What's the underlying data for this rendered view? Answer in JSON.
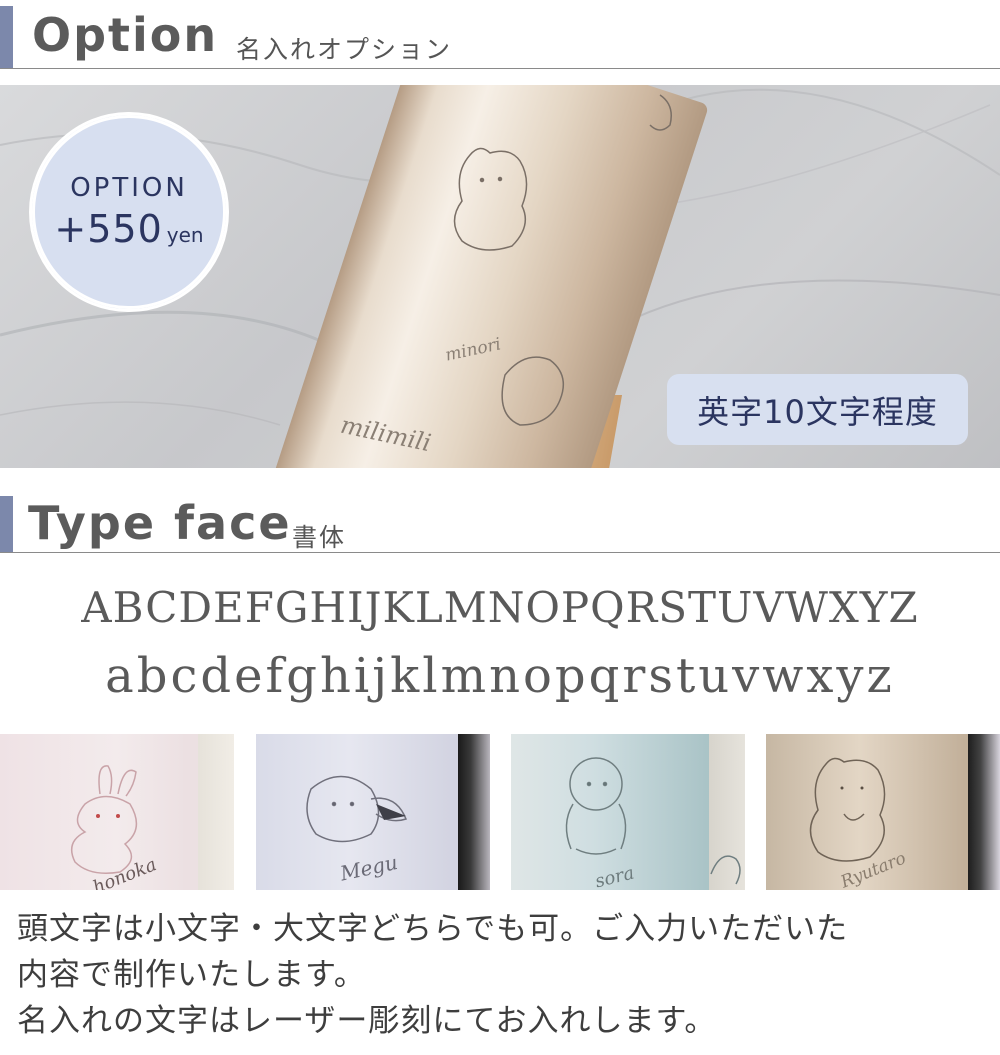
{
  "option_section": {
    "title": "Option",
    "subtitle": "名入れオプション"
  },
  "hero": {
    "badge_label": "OPTION",
    "badge_price": "+550",
    "badge_unit": "yen",
    "char_limit": "英字10文字程度",
    "engraving_name_1": "minori",
    "engraving_name_2": "milimili"
  },
  "typeface_section": {
    "title": "Type face",
    "subtitle": "書体"
  },
  "alphabet": {
    "uppercase": "ABCDEFGHIJKLMNOPQRSTUVWXYZ",
    "lowercase": "abcdefghijklmnopqrstuvwxyz"
  },
  "samples": [
    {
      "name": "honoka",
      "animal": "rabbit-icon"
    },
    {
      "name": "Megu",
      "animal": "bird-icon"
    },
    {
      "name": "sora",
      "animal": "poodle-icon"
    },
    {
      "name": "Ryutaro",
      "animal": "hamster-icon"
    }
  ],
  "notes": {
    "line1": "頭文字は小文字・大文字どちらでも可。ご入力いただいた",
    "line2": "内容で制作いたします。",
    "line3": "名入れの文字はレーザー彫刻にてお入れします。"
  },
  "colors": {
    "accent_bar": "#7c88ab",
    "badge_bg": "#d7dff0",
    "badge_text": "#2b3560"
  }
}
